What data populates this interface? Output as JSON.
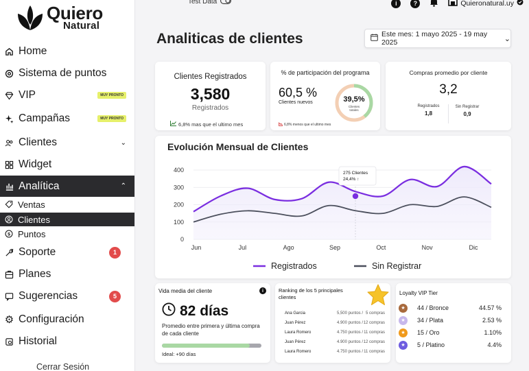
{
  "brand": {
    "name_top": "Quiero",
    "name_bottom": "Natural"
  },
  "topbar": {
    "test_label": "Test Data",
    "store_name": "Quieronatural.uy"
  },
  "sidebar": {
    "items": [
      {
        "label": "Home",
        "icon": "home-icon"
      },
      {
        "label": "Sistema de puntos",
        "icon": "points-icon"
      },
      {
        "label": "VIP",
        "icon": "diamond-icon",
        "badge": "MUY PRONTO"
      },
      {
        "label": "Campañas",
        "icon": "sparkle-icon",
        "badge": "MUY PRONTO"
      },
      {
        "label": "Clientes",
        "icon": "users-icon"
      },
      {
        "label": "Widget",
        "icon": "grid-icon"
      },
      {
        "label": "Analítica",
        "icon": "analytics-icon"
      },
      {
        "label": "Soporte",
        "icon": "wrench-icon",
        "count": "1"
      },
      {
        "label": "Planes",
        "icon": "box-icon"
      },
      {
        "label": "Sugerencias",
        "icon": "feedback-icon",
        "count": "5"
      },
      {
        "label": "Configuración",
        "icon": "gear-icon"
      },
      {
        "label": "Historial",
        "icon": "history-icon"
      }
    ],
    "sub_items": [
      {
        "label": "Ventas",
        "icon": "tag-icon"
      },
      {
        "label": "Clientes",
        "icon": "clients-icon"
      },
      {
        "label": "Puntos",
        "icon": "coin-icon"
      }
    ],
    "logout": "Cerrar Sesión"
  },
  "header": {
    "title": "Analiticas de clientes",
    "date_range": "Este mes: 1 mayo 2025 - 19 may 2025"
  },
  "kpi_registered": {
    "title": "Clientes Registrados",
    "value": "3,580",
    "caption": "Registrados",
    "trend": "6,8% mas que el ultimo mes"
  },
  "kpi_participation": {
    "title": "% de participación del programa",
    "value": "60,5 %",
    "caption": "Clientes nuevos",
    "ring_value": "39,5%",
    "ring_caption_1": "Clientes",
    "ring_caption_2": "totales",
    "ring_fraction": 0.395,
    "trend": "6,8% menos que el ultimo mes"
  },
  "kpi_purchases": {
    "title": "Compras promedio por cliente",
    "value": "3,2",
    "reg_label": "Registrados",
    "reg_value": "1,8",
    "noreg_label": "Sin Registrar",
    "noreg_value": "0,9"
  },
  "chart_data": {
    "type": "line",
    "title": "Evolución Mensual de Clientes",
    "x": [
      "Jun",
      "Jul",
      "Ago",
      "Sep",
      "Oct",
      "Nov",
      "Dic"
    ],
    "ylim": [
      0,
      400
    ],
    "yticks": [
      0,
      100,
      200,
      300,
      400
    ],
    "grid": true,
    "legend_position": "bottom",
    "series": [
      {
        "name": "Registrados",
        "color": "#7a2ee0",
        "values": [
          160,
          250,
          295,
          230,
          235,
          330,
          275,
          250,
          345,
          305,
          420,
          320
        ]
      },
      {
        "name": "Sin Registrar",
        "color": "#4b4f5c",
        "values": [
          100,
          145,
          165,
          150,
          135,
          195,
          165,
          150,
          200,
          190,
          245,
          185
        ]
      }
    ],
    "tooltip": {
      "line1": "275 Clientes",
      "line2": "24,4% ↑"
    }
  },
  "vida_media": {
    "title": "Vida media del cliente",
    "value": "82 días",
    "desc": "Promedio entre primera y última compra de cada cliente",
    "progress": 0.88,
    "ideal": "Ideal: +90 días"
  },
  "ranking": {
    "title": "Ranking de los 5 principales clientes",
    "rows": [
      {
        "name": "Ana Garcia",
        "points": "5,500 puntos",
        "purchases": "5 compras"
      },
      {
        "name": "Juan Pérez",
        "points": "4.900 puntos",
        "purchases": "12 compras"
      },
      {
        "name": "Laura Romero",
        "points": "4.750 puntos",
        "purchases": "11 compras"
      },
      {
        "name": "Juan Pérez",
        "points": "4.900 puntos",
        "purchases": "12 compras"
      },
      {
        "name": "Laura Romero",
        "points": "4.750 puntos",
        "purchases": "11 compras"
      }
    ]
  },
  "loyalty": {
    "title": "Loyalty VIP Tier",
    "tiers": [
      {
        "label": "44 / Bronce",
        "pct": "44.57 %",
        "color": "#a86a3d"
      },
      {
        "label": "34 / Plata",
        "pct": "2.53 %",
        "color": "#c7b8ec"
      },
      {
        "label": "15 / Oro",
        "pct": "1.10%",
        "color": "#f09a1c"
      },
      {
        "label": "5 / Platino",
        "pct": "4.4%",
        "color": "#6e5ce0"
      }
    ]
  }
}
